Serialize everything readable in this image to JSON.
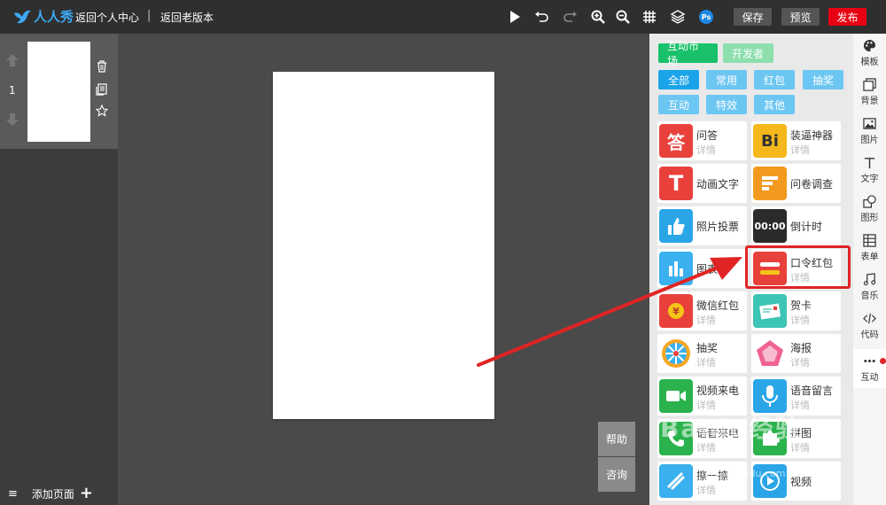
{
  "topbar": {
    "brand": "人人秀",
    "back_personal": "返回个人中心",
    "separator": "|",
    "back_old": "返回老版本",
    "ps_label": "Ps",
    "save": "保存",
    "preview": "预览",
    "publish": "发布",
    "colors": {
      "bg": "#2f2f2f",
      "publish": "#e60012",
      "brand": "#3fa9f5"
    }
  },
  "pages": {
    "current_page": "1",
    "menu_glyph": "≡",
    "add_page": "添加页面",
    "add_glyph": "+"
  },
  "float_buttons": {
    "help": "帮助",
    "consult": "咨询"
  },
  "interact_panel": {
    "tabs": [
      {
        "label": "互动市场"
      },
      {
        "label": "开发者"
      }
    ],
    "filters": [
      "全部",
      "常用",
      "红包",
      "抽奖",
      "互动",
      "特效",
      "其他"
    ],
    "detail_label": "详情",
    "items": [
      {
        "name": "问答",
        "icon": "answer-icon",
        "glyph": "答",
        "color": "#e8413c"
      },
      {
        "name": "装逼神器",
        "icon": "bi-icon",
        "glyph": "Bi",
        "color": "#f5b81c"
      },
      {
        "name": "动画文字",
        "icon": "text-t-icon",
        "glyph": "T",
        "color": "#e8413c"
      },
      {
        "name": "问卷调查",
        "icon": "survey-icon",
        "glyph": "",
        "color": "#f39a1e"
      },
      {
        "name": "照片投票",
        "icon": "thumbs-up-icon",
        "glyph": "",
        "color": "#2aa6e8"
      },
      {
        "name": "倒计时",
        "icon": "countdown-icon",
        "glyph": "00:00",
        "color": "#2b2b2b"
      },
      {
        "name": "图表",
        "icon": "bar-chart-icon",
        "glyph": "",
        "color": "#3ab0ee"
      },
      {
        "name": "口令红包",
        "icon": "password-redpacket-icon",
        "glyph": "",
        "color": "#e8413c"
      },
      {
        "name": "微信红包",
        "icon": "wechat-redpacket-icon",
        "glyph": "¥",
        "color": "#e8413c"
      },
      {
        "name": "贺卡",
        "icon": "greeting-card-icon",
        "glyph": "",
        "color": "#3cc4b4"
      },
      {
        "name": "抽奖",
        "icon": "lottery-wheel-icon",
        "glyph": "",
        "color": "#f5a623"
      },
      {
        "name": "海报",
        "icon": "poster-icon",
        "glyph": "",
        "color": "#f06292"
      },
      {
        "name": "视频来电",
        "icon": "video-call-icon",
        "glyph": "",
        "color": "#2ab24c"
      },
      {
        "name": "语音留言",
        "icon": "microphone-icon",
        "glyph": "",
        "color": "#2aa6e8"
      },
      {
        "name": "语音来电",
        "icon": "phone-icon",
        "glyph": "",
        "color": "#2ab24c"
      },
      {
        "name": "拼图",
        "icon": "puzzle-icon",
        "glyph": "",
        "color": "#2ab24c"
      },
      {
        "name": "擦一擦",
        "icon": "scratch-icon",
        "glyph": "",
        "color": "#3ab0ee"
      },
      {
        "name": "视频",
        "icon": "video-play-icon",
        "glyph": "",
        "color": "#2aa6e8"
      }
    ],
    "colors": {
      "active_tab": "#19c26a",
      "active_filter": "#1aa3e8",
      "filter": "#6cc6f2"
    }
  },
  "right_toolbar": [
    {
      "label": "模板",
      "icon": "palette-icon"
    },
    {
      "label": "背景",
      "icon": "background-icon"
    },
    {
      "label": "图片",
      "icon": "image-icon"
    },
    {
      "label": "文字",
      "icon": "text-icon"
    },
    {
      "label": "图形",
      "icon": "shape-icon"
    },
    {
      "label": "表单",
      "icon": "table-icon"
    },
    {
      "label": "音乐",
      "icon": "music-icon"
    },
    {
      "label": "代码",
      "icon": "code-icon"
    },
    {
      "label": "互动",
      "icon": "more-dots-icon"
    }
  ],
  "watermark": {
    "logo": "Baidu经验",
    "url": "jingyan.baidu.com"
  }
}
